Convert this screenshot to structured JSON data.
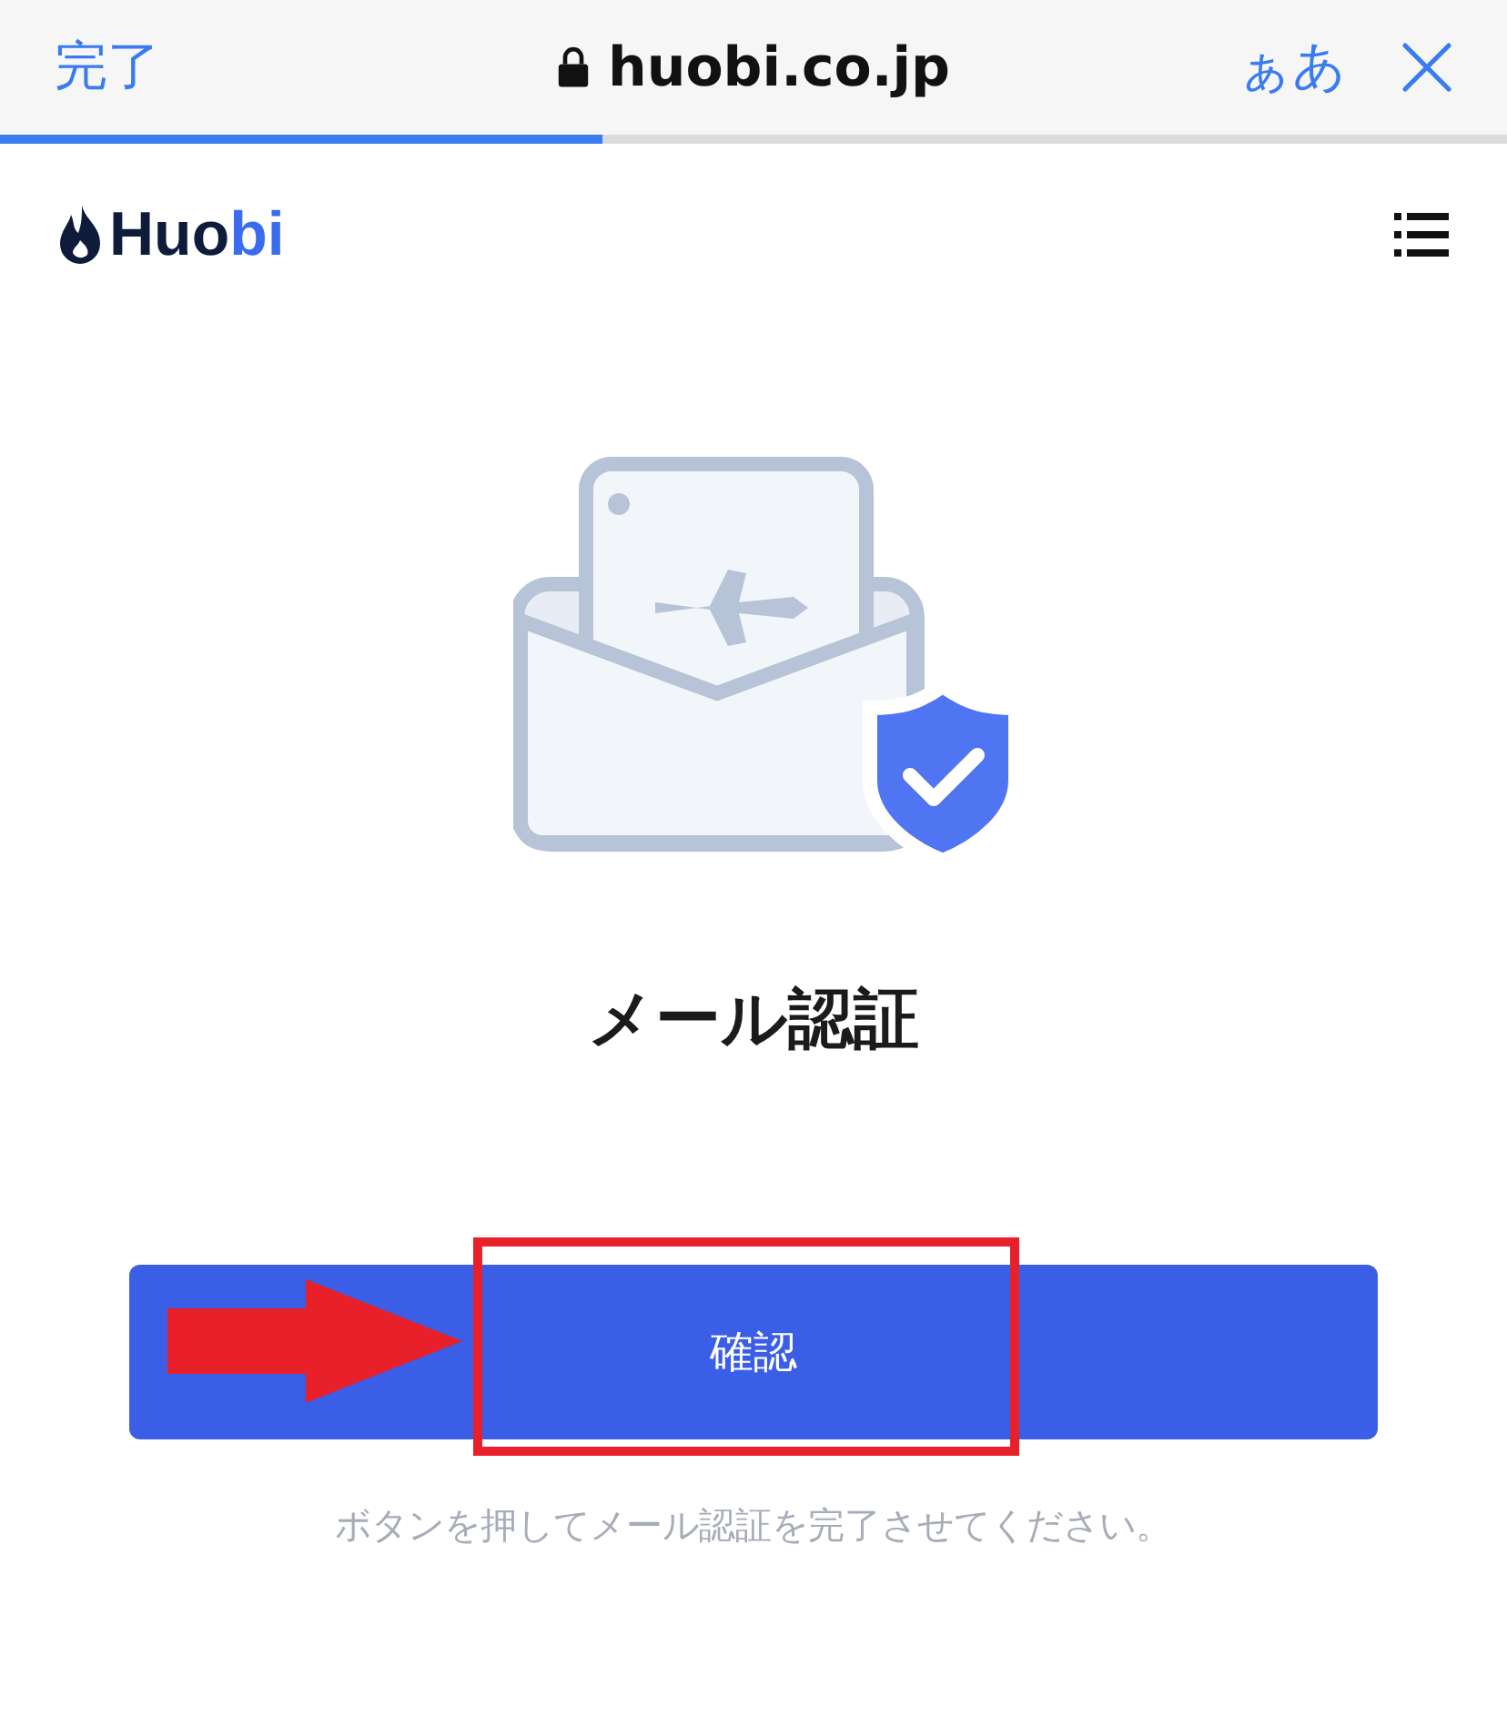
{
  "browser_bar": {
    "done_label": "完了",
    "url": "huobi.co.jp",
    "text_size_label": "ぁあ",
    "load_progress": {
      "level": 0.4
    }
  },
  "header": {
    "logo_dark": "Huo",
    "logo_accent": "bi"
  },
  "title": "メール認証",
  "confirm_button": {
    "label": "確認"
  },
  "caption": "ボタンを押してメール認証を完了させてください。"
}
